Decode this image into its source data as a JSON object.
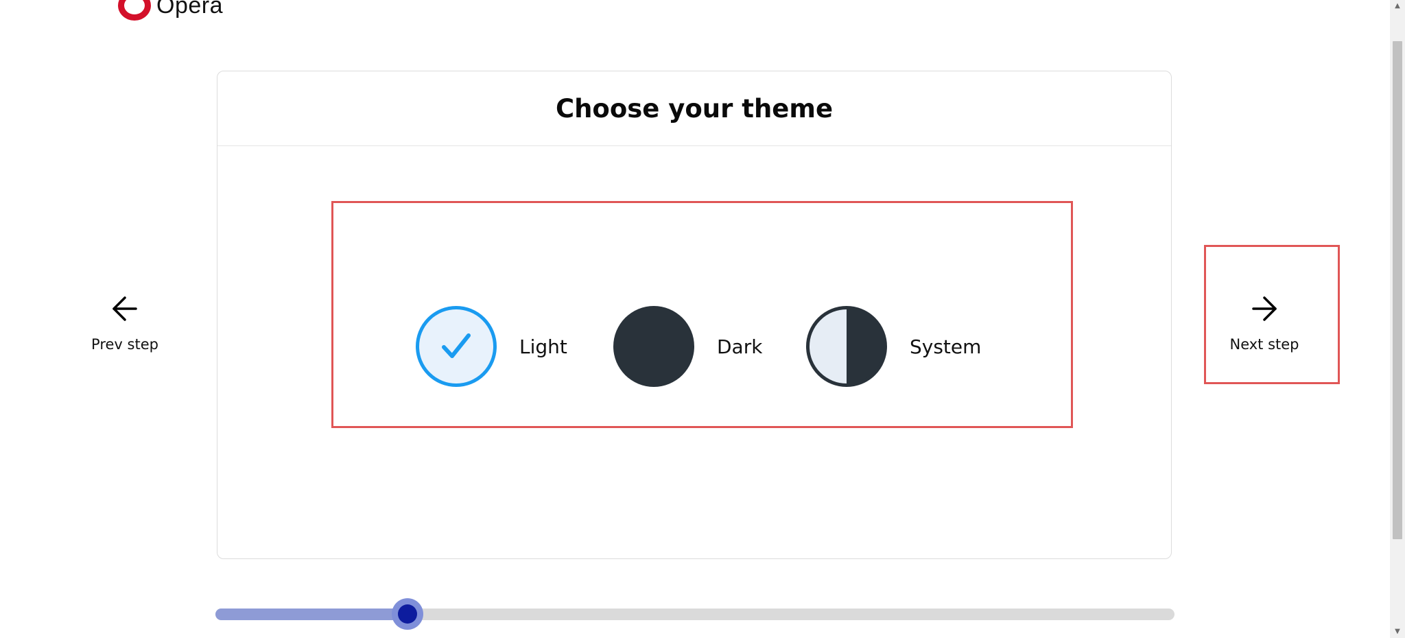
{
  "logo": {
    "text": "Opera"
  },
  "card": {
    "title": "Choose your theme"
  },
  "themes": [
    {
      "id": "light",
      "label": "Light",
      "selected": true
    },
    {
      "id": "dark",
      "label": "Dark",
      "selected": false
    },
    {
      "id": "system",
      "label": "System",
      "selected": false
    }
  ],
  "nav": {
    "prev_label": "Prev step",
    "next_label": "Next step"
  },
  "progress": {
    "fraction": 0.2
  },
  "colors": {
    "brand": "#d3102a",
    "selected_accent": "#1a9bf0",
    "dark_theme": "#29323a",
    "highlight_border": "#e05656",
    "slider_handle": "#0d1c9e"
  },
  "icons": {
    "logo": "opera-logo-icon",
    "check": "check-icon",
    "prev": "arrow-left-icon",
    "next": "arrow-right-icon"
  }
}
